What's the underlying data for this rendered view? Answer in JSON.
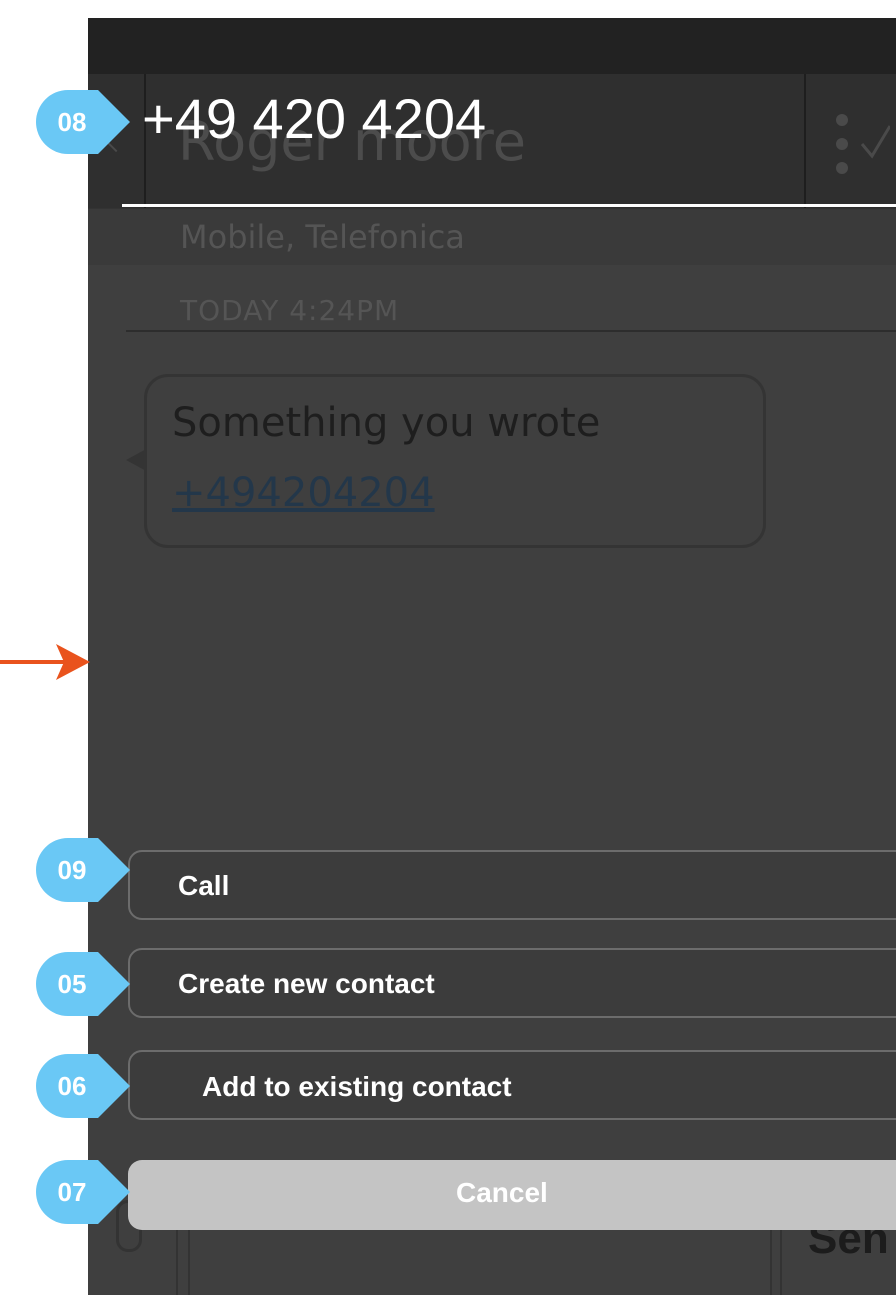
{
  "contact": {
    "name": "Roger moore",
    "subtitle": "Mobile, Telefonica",
    "timestamp": "TODAY 4:24PM"
  },
  "message": {
    "text": "Something you wrote",
    "link": "+494204204"
  },
  "compose": {
    "send_label": "Sen"
  },
  "overlay": {
    "number": "+49 420 4204",
    "actions": [
      {
        "label": "Call"
      },
      {
        "label": "Create new contact"
      },
      {
        "label": "Add to existing contact"
      }
    ],
    "cancel_label": "Cancel"
  },
  "markers": [
    "08",
    "09",
    "05",
    "06",
    "07"
  ],
  "colors": {
    "marker": "#6ac8f5",
    "arrow": "#e9531d",
    "cancel": "#c4c4c4"
  },
  "icons": [
    "back-chevron-icon",
    "menu-icon",
    "check-icon",
    "paperclip-icon",
    "arrow-icon"
  ]
}
